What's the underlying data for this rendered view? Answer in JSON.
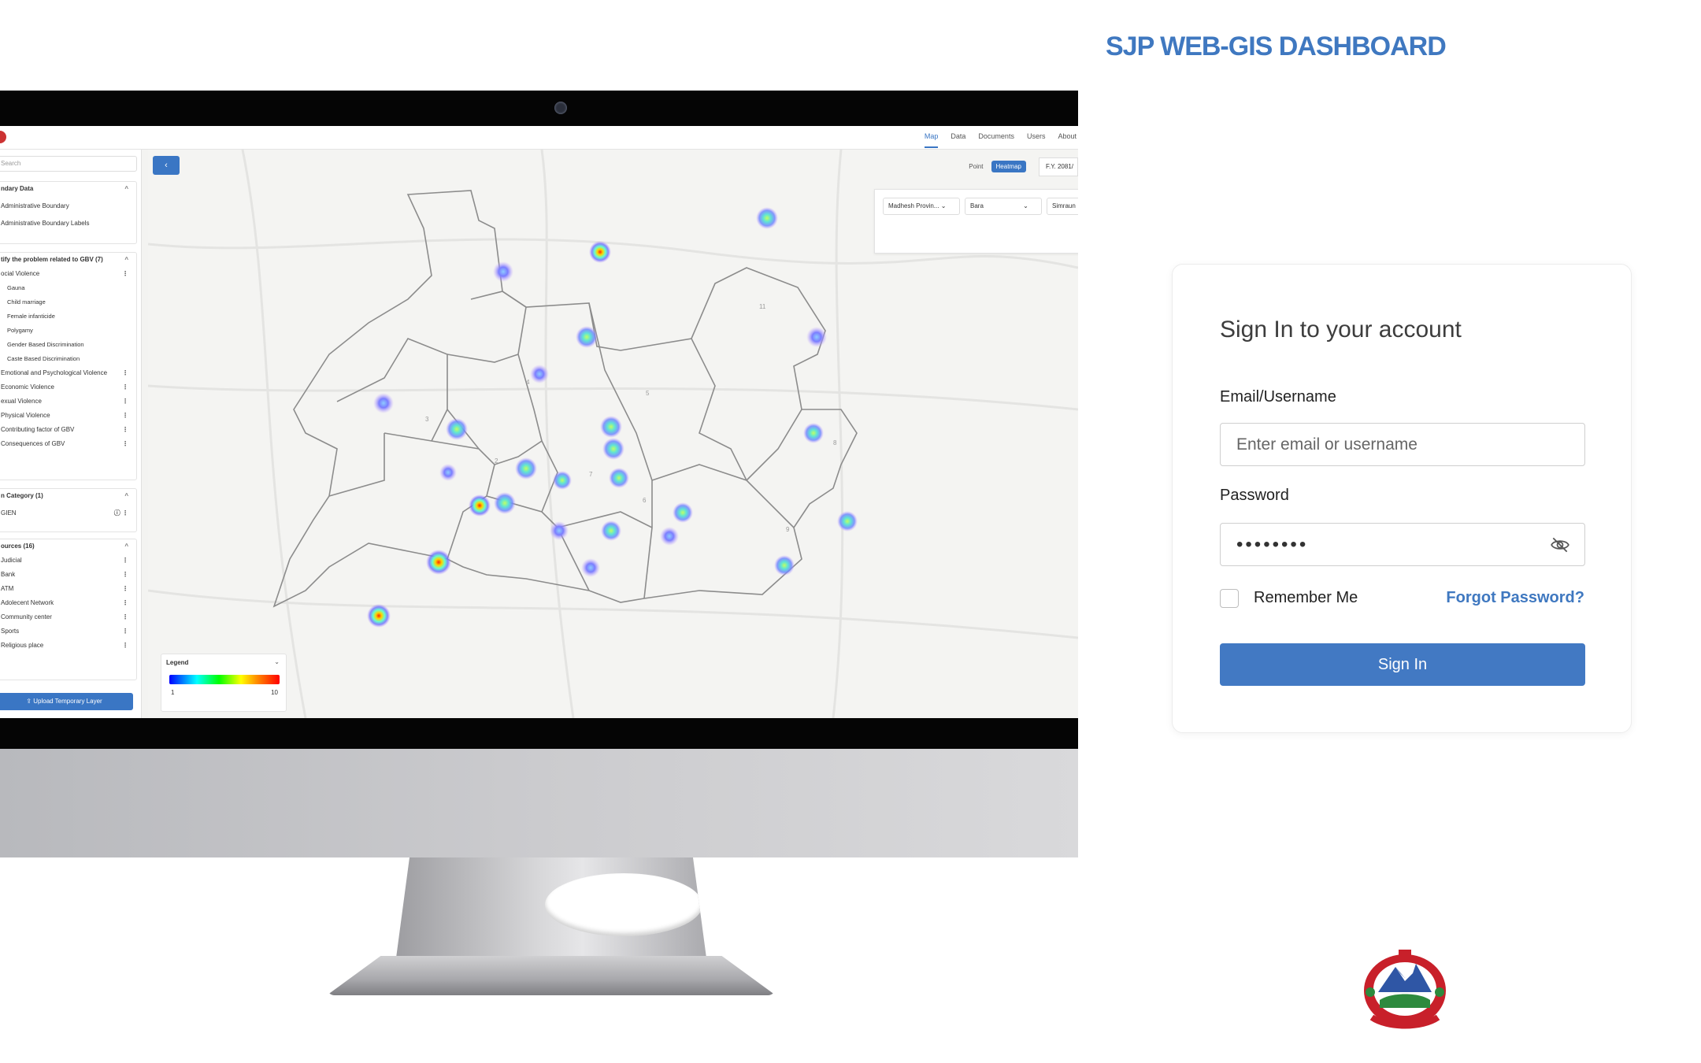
{
  "brand": {
    "title": "SJP WEB-GIS DASHBOARD"
  },
  "login": {
    "heading": "Sign In to your account",
    "email_label": "Email/Username",
    "email_placeholder": "Enter email or username",
    "password_label": "Password",
    "password_value": "password",
    "remember_label": "Remember Me",
    "forgot_label": "Forgot Password?",
    "signin_label": "Sign In",
    "accent_color": "#4279c3"
  },
  "preview": {
    "nav": [
      "Map",
      "Data",
      "Documents",
      "Users",
      "About"
    ],
    "search_placeholder": "Search",
    "boundary": {
      "title": "ndary Data",
      "items": [
        "Administrative Boundary",
        "Administrative Boundary Labels"
      ]
    },
    "gbv": {
      "title": "tify the problem related to GBV (7)",
      "items": [
        {
          "label": "ocial Violence",
          "sub": [
            "Gauna",
            "Child marriage",
            "Female infanticide",
            "Polygamy",
            "Gender Based Discrimination",
            "Caste Based Discrimination"
          ]
        },
        {
          "label": "Emotional and Psychological Violence"
        },
        {
          "label": "Economic Violence"
        },
        {
          "label": "exual Violence"
        },
        {
          "label": "Physical Violence"
        },
        {
          "label": "Contributing factor of GBV"
        },
        {
          "label": "Consequences of GBV"
        }
      ]
    },
    "category": {
      "title": "n Category (1)",
      "items": [
        "GIEN"
      ]
    },
    "sources": {
      "title": "ources (16)",
      "items": [
        "Judicial",
        "Bank",
        "ATM",
        "Adolecent Network",
        "Community center",
        "Sports",
        "Religious place"
      ]
    },
    "upload_label": "Upload Temporary Layer",
    "collapse_label": "‹",
    "toggle": {
      "point": "Point",
      "heatmap": "Heatmap"
    },
    "fiscal_year": "F.Y. 2081/",
    "filters": [
      "Madhesh Provin...",
      "Bara",
      "Simraun"
    ],
    "legend": {
      "title": "Legend",
      "min": "1",
      "max": "10"
    },
    "ward_labels": [
      "11",
      "4",
      "5",
      "3",
      "8",
      "2",
      "7",
      "6",
      "9"
    ]
  }
}
